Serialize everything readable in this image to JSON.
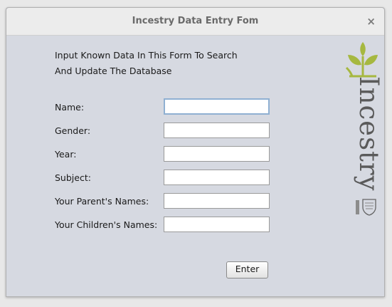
{
  "window": {
    "title": "Incestry Data Entry Fom",
    "close_glyph": "×",
    "close_icon": "close-icon"
  },
  "intro": {
    "line1": "Input Known Data In This Form To Search",
    "line2": "And Update The Database"
  },
  "form": {
    "fields": [
      {
        "label": "Name:",
        "value": ""
      },
      {
        "label": "Gender:",
        "value": ""
      },
      {
        "label": "Year:",
        "value": ""
      },
      {
        "label": "Subject:",
        "value": ""
      },
      {
        "label": "Your Parent's Names:",
        "value": ""
      },
      {
        "label": "Your Children's Names:",
        "value": ""
      }
    ],
    "submit_label": "Enter"
  },
  "logo": {
    "text": "Incestry",
    "icon": "sprout-icon",
    "crest_icon": "university-crest-icon",
    "accent_color": "#a6b840"
  }
}
